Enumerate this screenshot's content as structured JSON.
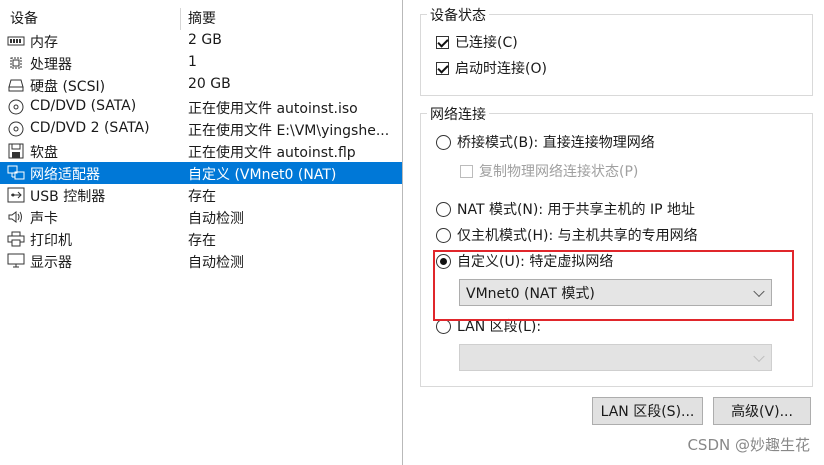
{
  "device_list": {
    "col_device": "设备",
    "col_summary": "摘要",
    "rows": [
      {
        "icon": "memory-icon",
        "name": "内存",
        "summary": "2 GB"
      },
      {
        "icon": "processor-icon",
        "name": "处理器",
        "summary": "1"
      },
      {
        "icon": "hard-disk-icon",
        "name": "硬盘 (SCSI)",
        "summary": "20 GB"
      },
      {
        "icon": "cd-dvd-icon",
        "name": "CD/DVD (SATA)",
        "summary": "正在使用文件 autoinst.iso"
      },
      {
        "icon": "cd-dvd-icon",
        "name": "CD/DVD 2 (SATA)",
        "summary": "正在使用文件 E:\\VM\\yingshe..."
      },
      {
        "icon": "floppy-icon",
        "name": "软盘",
        "summary": "正在使用文件 autoinst.flp"
      },
      {
        "icon": "network-adapter-icon",
        "name": "网络适配器",
        "summary": "自定义 (VMnet0 (NAT)",
        "selected": true
      },
      {
        "icon": "usb-icon",
        "name": "USB 控制器",
        "summary": "存在"
      },
      {
        "icon": "sound-icon",
        "name": "声卡",
        "summary": "自动检测"
      },
      {
        "icon": "printer-icon",
        "name": "打印机",
        "summary": "存在"
      },
      {
        "icon": "display-icon",
        "name": "显示器",
        "summary": "自动检测"
      }
    ]
  },
  "device_status": {
    "title": "设备状态",
    "connected": {
      "label": "已连接(C)",
      "checked": true
    },
    "connect_at_power_on": {
      "label": "启动时连接(O)",
      "checked": true
    }
  },
  "network_connection": {
    "title": "网络连接",
    "bridged": {
      "label": "桥接模式(B): 直接连接物理网络",
      "selected": false
    },
    "replicate": {
      "label": "复制物理网络连接状态(P)",
      "checked": false,
      "enabled": false
    },
    "nat": {
      "label": "NAT 模式(N): 用于共享主机的 IP 地址",
      "selected": false
    },
    "host_only": {
      "label": "仅主机模式(H): 与主机共享的专用网络",
      "selected": false
    },
    "custom": {
      "label": "自定义(U): 特定虚拟网络",
      "selected": true
    },
    "custom_select_value": "VMnet0 (NAT 模式)",
    "lan_segment": {
      "label": "LAN 区段(L):",
      "selected": false
    },
    "lan_select_value": ""
  },
  "buttons": {
    "lan_segments": "LAN 区段(S)...",
    "advanced": "高级(V)..."
  },
  "watermark": "CSDN @妙趣生花",
  "colors": {
    "selection": "#0078d7",
    "highlight_box": "#e0262b"
  }
}
